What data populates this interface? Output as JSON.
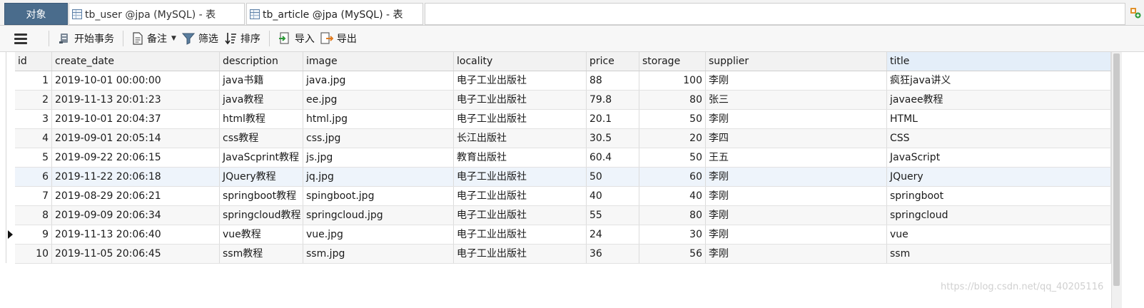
{
  "tabs": {
    "objects_label": "对象",
    "user_label": "tb_user @jpa (MySQL) - 表",
    "article_label": "tb_article @jpa (MySQL) - 表"
  },
  "toolbar": {
    "begin_transaction": "开始事务",
    "note": "备注",
    "filter": "筛选",
    "sort": "排序",
    "import": "导入",
    "export": "导出"
  },
  "grid": {
    "columns": [
      "id",
      "create_date",
      "description",
      "image",
      "locality",
      "price",
      "storage",
      "supplier",
      "title"
    ],
    "rows": [
      [
        "1",
        "2019-10-01 00:00:00",
        "java书籍",
        "java.jpg",
        "电子工业出版社",
        "88",
        "100",
        "李刚",
        "疯狂java讲义"
      ],
      [
        "2",
        "2019-11-13 20:01:23",
        "java教程",
        "ee.jpg",
        "电子工业出版社",
        "79.8",
        "80",
        "张三",
        "javaee教程"
      ],
      [
        "3",
        "2019-10-01 20:04:37",
        "html教程",
        "html.jpg",
        "电子工业出版社",
        "20.1",
        "50",
        "李刚",
        "HTML"
      ],
      [
        "4",
        "2019-09-01 20:05:14",
        "css教程",
        "css.jpg",
        "长江出版社",
        "30.5",
        "20",
        "李四",
        "CSS"
      ],
      [
        "5",
        "2019-09-22 20:06:15",
        "JavaScprint教程",
        "js.jpg",
        "教育出版社",
        "60.4",
        "50",
        "王五",
        "JavaScript"
      ],
      [
        "6",
        "2019-11-22 20:06:18",
        "JQuery教程",
        "jq.jpg",
        "电子工业出版社",
        "50",
        "60",
        "李刚",
        "JQuery"
      ],
      [
        "7",
        "2019-08-29 20:06:21",
        "springboot教程",
        "spingboot.jpg",
        "电子工业出版社",
        "40",
        "40",
        "李刚",
        "springboot"
      ],
      [
        "8",
        "2019-09-09 20:06:34",
        "springcloud教程",
        "springcloud.jpg",
        "电子工业出版社",
        "55",
        "80",
        "李刚",
        "springcloud"
      ],
      [
        "9",
        "2019-11-13 20:06:40",
        "vue教程",
        "vue.jpg",
        "电子工业出版社",
        "24",
        "30",
        "李刚",
        "vue"
      ],
      [
        "10",
        "2019-11-05 20:06:45",
        "ssm教程",
        "ssm.jpg",
        "电子工业出版社",
        "36",
        "56",
        "李刚",
        "ssm"
      ]
    ],
    "current_row_index": 8
  },
  "watermark": "https://blog.csdn.net/qq_40205116",
  "colors": {
    "objects_tab": "#4a6c8c",
    "selected_header": "#e4eef9",
    "highlight_row": "#eef4fb"
  }
}
